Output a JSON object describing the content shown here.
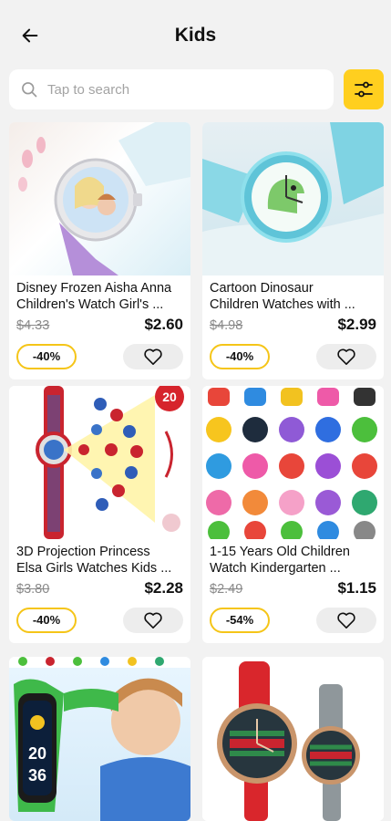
{
  "header": {
    "title": "Kids"
  },
  "search": {
    "placeholder": "Tap to search",
    "value": ""
  },
  "products": [
    {
      "line1": "Disney Frozen Aisha Anna",
      "line2": "Children's Watch Girl's ...",
      "old_price": "$4.33",
      "price": "$2.60",
      "discount": "-40%"
    },
    {
      "line1": "Cartoon Dinosaur",
      "line2": "Children Watches with ...",
      "old_price": "$4.98",
      "price": "$2.99",
      "discount": "-40%"
    },
    {
      "line1": "3D Projection Princess",
      "line2": "Elsa Girls Watches Kids ...",
      "old_price": "$3.80",
      "price": "$2.28",
      "discount": "-40%"
    },
    {
      "line1": "1-15 Years Old Children",
      "line2": "Watch Kindergarten ...",
      "old_price": "$2.49",
      "price": "$1.15",
      "discount": "-54%"
    }
  ],
  "images": {
    "spider_badge": "20",
    "band_time_hour": "20",
    "band_time_min": "36"
  },
  "colors": {
    "accent": "#ffcf1f",
    "discount_border": "#f5c518"
  },
  "icons": [
    "back-arrow-icon",
    "search-icon",
    "filter-sliders-icon",
    "heart-outline-icon"
  ]
}
